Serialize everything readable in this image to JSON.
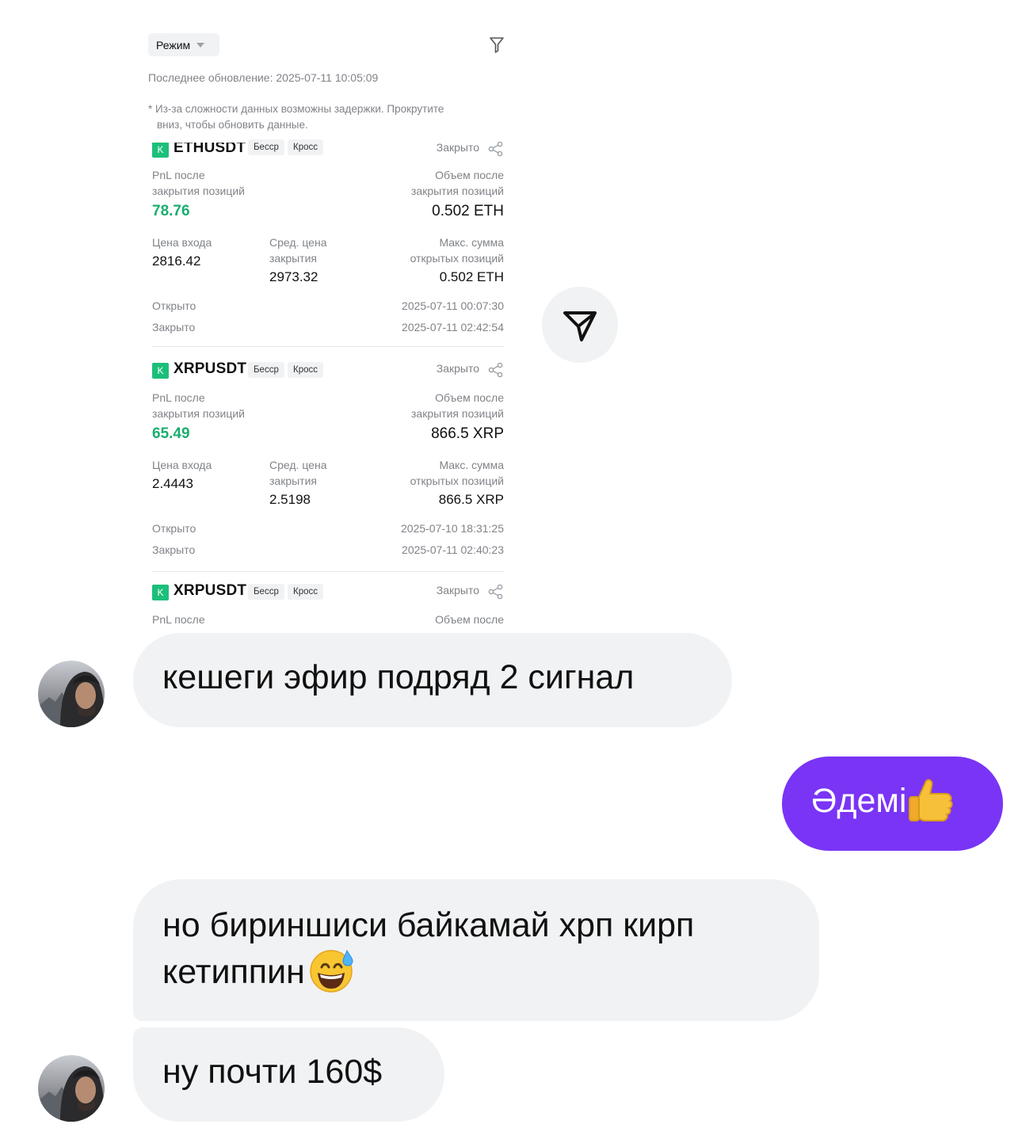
{
  "screenshot": {
    "mode_label": "Режим",
    "last_update": "Последнее обновление: 2025-07-11 10:05:09",
    "note_line1": "* Из-за сложности данных возможны задержки. Прокрутите",
    "note_line2": "вниз, чтобы обновить данные.",
    "positions": [
      {
        "symbol": "ETHUSDT",
        "tag1": "Бесср",
        "tag2": "Кросс",
        "status": "Закрыто",
        "pnl_label_1": "PnL после",
        "pnl_label_2": "закрытия позиций",
        "pnl_value": "78.76",
        "volume_label_1": "Объем после",
        "volume_label_2": "закрытия позиций",
        "volume_value": "0.502 ETH",
        "entry_label": "Цена входа",
        "entry_value": "2816.42",
        "avg_close_label_1": "Сред. цена",
        "avg_close_label_2": "закрытия",
        "avg_close_value": "2973.32",
        "max_label_1": "Макс. сумма",
        "max_label_2": "открытых позиций",
        "max_value": "0.502 ETH",
        "opened_label": "Открыто",
        "opened_time": "2025-07-11 00:07:30",
        "closed_label": "Закрыто",
        "closed_time": "2025-07-11 02:42:54"
      },
      {
        "symbol": "XRPUSDT",
        "tag1": "Бесср",
        "tag2": "Кросс",
        "status": "Закрыто",
        "pnl_label_1": "PnL после",
        "pnl_label_2": "закрытия позиций",
        "pnl_value": "65.49",
        "volume_label_1": "Объем после",
        "volume_label_2": "закрытия позиций",
        "volume_value": "866.5 XRP",
        "entry_label": "Цена входа",
        "entry_value": "2.4443",
        "avg_close_label_1": "Сред. цена",
        "avg_close_label_2": "закрытия",
        "avg_close_value": "2.5198",
        "max_label_1": "Макс. сумма",
        "max_label_2": "открытых позиций",
        "max_value": "866.5 XRP",
        "opened_label": "Открыто",
        "opened_time": "2025-07-10 18:31:25",
        "closed_label": "Закрыто",
        "closed_time": "2025-07-11 02:40:23"
      },
      {
        "symbol": "XRPUSDT",
        "tag1": "Бесср",
        "tag2": "Кросс",
        "status": "Закрыто",
        "pnl_label_1": "PnL после",
        "volume_label_1": "Объем после"
      }
    ]
  },
  "messages": [
    {
      "side": "incoming",
      "text": "кешеги эфир подряд 2 сигнал"
    },
    {
      "side": "outgoing",
      "text": "Әдемі",
      "emoji": "thumbs-up"
    },
    {
      "side": "incoming",
      "text_line1": "но бириншиси байкамай хрп кирп",
      "text_line2": "кетиппин",
      "emoji": "grinning-sweat"
    },
    {
      "side": "incoming",
      "text": "ну почти 160$"
    }
  ],
  "colors": {
    "incoming_bubble": "#f1f2f4",
    "outgoing_bubble": "#7a34f5",
    "pnl_positive": "#1aae6f",
    "exchange_logo": "#1cbf7a"
  }
}
